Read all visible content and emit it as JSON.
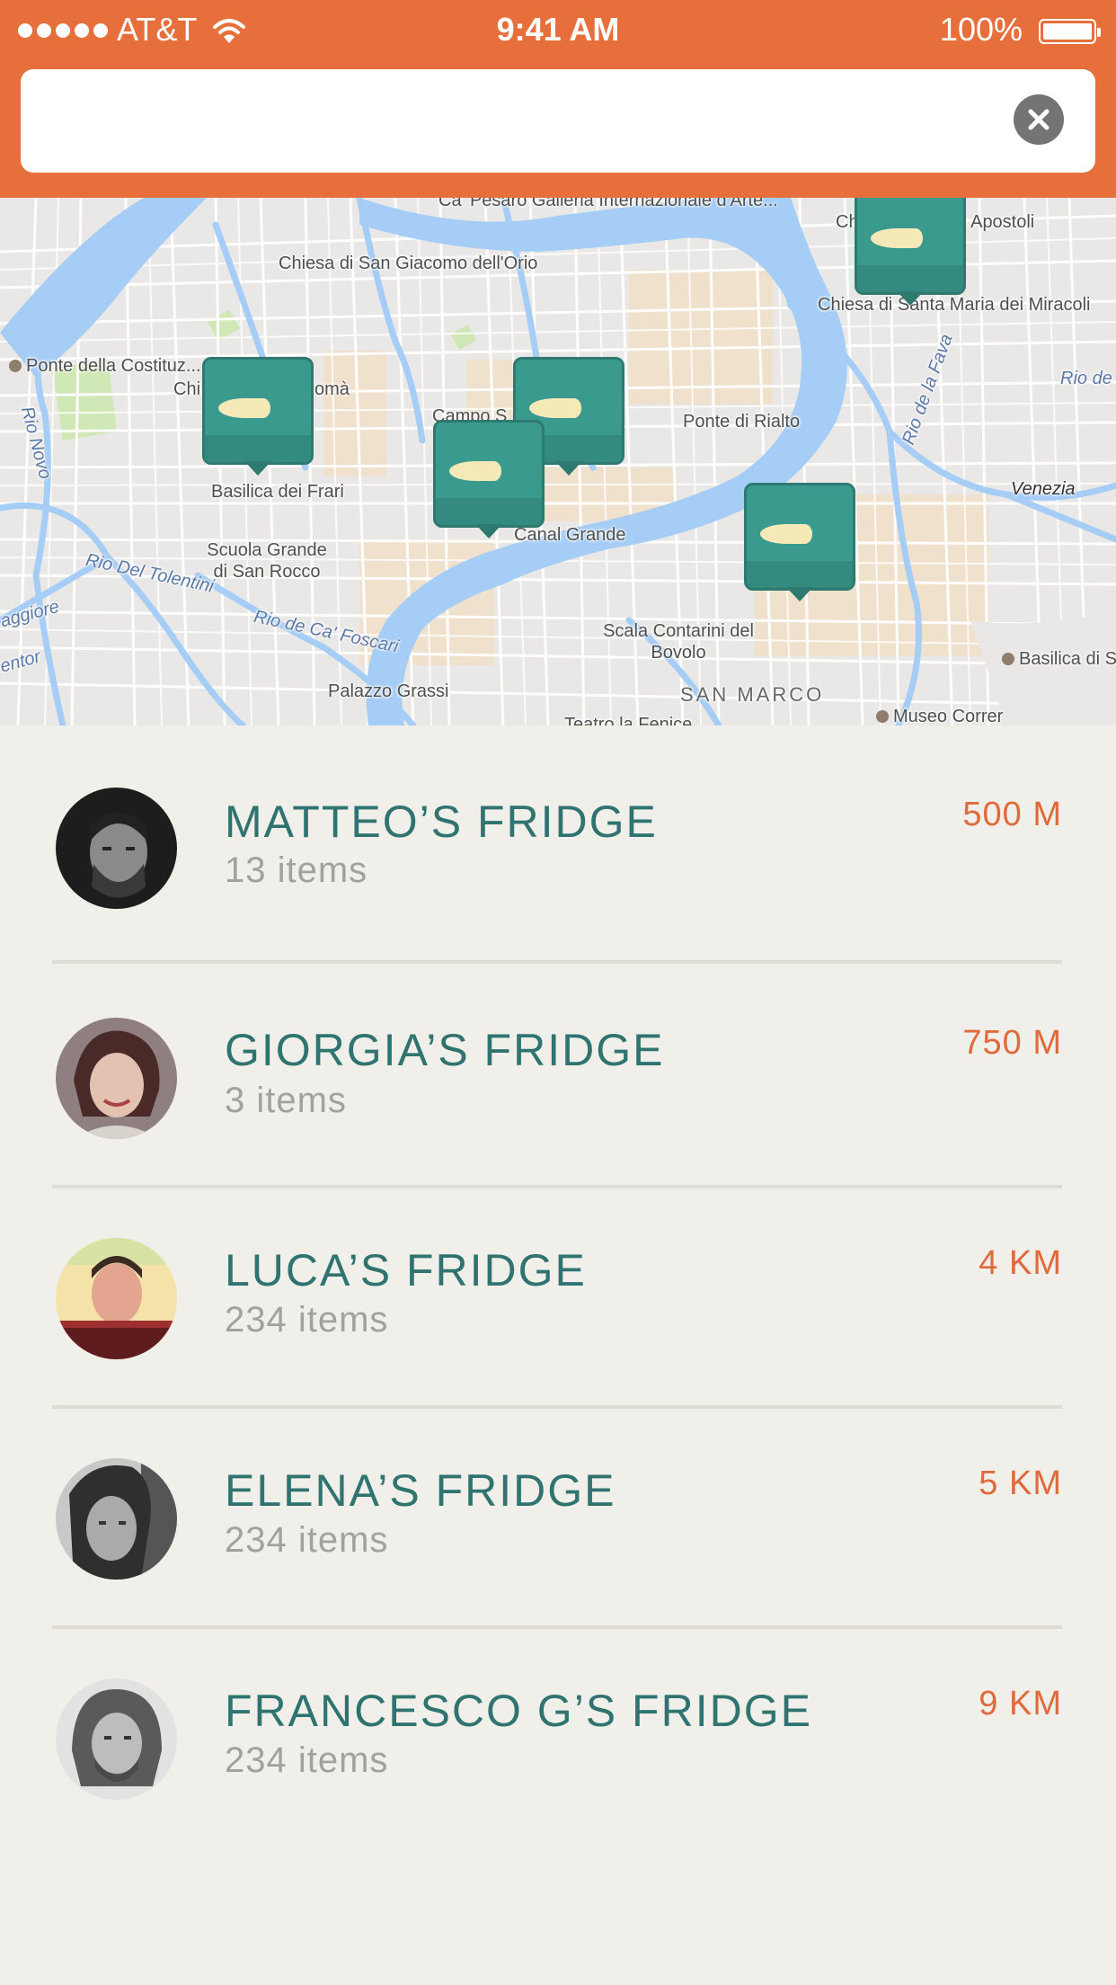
{
  "status_bar": {
    "carrier": "AT&T",
    "time": "9:41 AM",
    "battery": "100%"
  },
  "search": {
    "value": "",
    "placeholder": "",
    "clear_icon": "close-icon"
  },
  "map": {
    "labels": {
      "ca_pesaro": "Ca' Pesaro Galleria Internazionale d'Arte...",
      "chiesa_san_giacomo": "Chiesa di San Giacomo dell'Orio",
      "apostoli": "Chiesa dei Santi Apostoli",
      "miracoli": "Chiesa di Santa Maria dei Miracoli",
      "ponte_costituzione": "Ponte della Costituz...",
      "ponte_rialto": "Ponte di Rialto",
      "rio_fava": "Rio de la Fava",
      "rio_de": "Rio de",
      "venezia": "Venezia",
      "rio_novo": "Rio Novo",
      "basilica_frari": "Basilica dei Frari",
      "scuola_rocco": "Scuola Grande di San Rocco",
      "canal_grande": "Canal Grande",
      "rio_tolentini": "Rio Del Tolentini",
      "rio_foscari": "Rio de Ca' Foscari",
      "scala_bovolo": "Scala Contarini del Bovolo",
      "basilica_marco": "Basilica di S",
      "palazzo_grassi": "Palazzo Grassi",
      "san_marco": "SAN MARCO",
      "museo_correr": "Museo Correr",
      "teatro_fenice": "Teatro la Fenice",
      "campo": "Campo S",
      "chi": "Chi",
      "toma": "omà",
      "aggiore": "aggiore",
      "entor": "entor"
    },
    "pins": [
      "fridge-pin",
      "fridge-pin",
      "fridge-pin",
      "fridge-pin",
      "fridge-pin"
    ],
    "colors": {
      "pin": "#3b9a8e",
      "water": "#a5cdf5",
      "land": "#e9e8e6",
      "street": "#ffffff"
    }
  },
  "fridges": [
    {
      "name": "MATTEO’S FRIDGE",
      "items": "13 items",
      "distance": "500 M"
    },
    {
      "name": "GIORGIA’S FRIDGE",
      "items": "3 items",
      "distance": "750 M"
    },
    {
      "name": "LUCA’S FRIDGE",
      "items": "234 items",
      "distance": "4 KM"
    },
    {
      "name": "ELENA’S FRIDGE",
      "items": "234 items",
      "distance": "5 KM"
    },
    {
      "name": "FRANCESCO G’S FRIDGE",
      "items": "234 items",
      "distance": "9 KM"
    }
  ],
  "colors": {
    "header": "#e76f3b",
    "title": "#2f7470",
    "distance": "#e06a3b",
    "subtitle": "#a3a19c",
    "background": "#f0efe9"
  }
}
